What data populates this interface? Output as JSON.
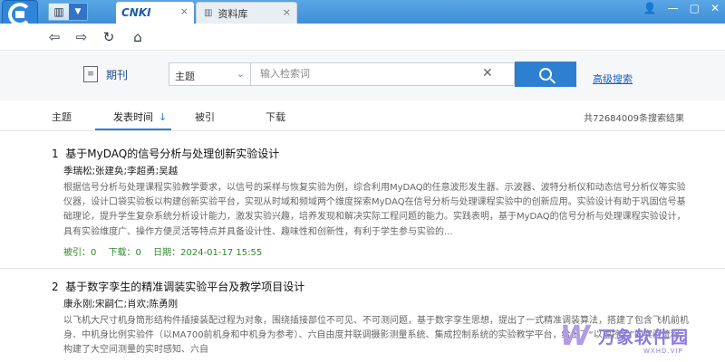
{
  "titlebar": {
    "tabs": [
      {
        "label": "CNKI",
        "icon": "cnki-icon",
        "active": true
      },
      {
        "label": "资料库",
        "icon": "library-icon",
        "active": false
      }
    ],
    "close_glyph": "×"
  },
  "search": {
    "source_label": "期刊",
    "field": "主题",
    "placeholder": "输入检索词",
    "advanced_label": "高级搜索"
  },
  "sort": {
    "options": [
      "主题",
      "发表时间",
      "被引",
      "下载"
    ],
    "active": "发表时间",
    "result_count": "共72684009条搜索结果"
  },
  "results": [
    {
      "index": "1",
      "title": "基于MyDAQ的信号分析与处理创新实验设计",
      "authors": "季瑞松;张建奂;李超勇;吴越",
      "abstract": "根据信号分析与处理课程实验教学要求，以信号的采样与恢复实验为例，综合利用MyDAQ的任意波形发生器、示波器、波特分析仪和动态信号分析仪等实验仪器，设计口袋实验板以构建创新实验平台，实现从时域和频域两个维度探索MyDAQ在信号分析与处理课程实验中的创新应用。实验设计有助于巩固信号基础理论，提升学生复杂系统分析设计能力，激发实验兴趣，培养发现和解决实际工程问题的能力。实践表明，基于MyDAQ的信号分析与处理课程实验设计，具有实验维度广、操作方便灵活等特点并具备设计性、趣味性和创新性，有利于学生参与实验的...",
      "cited": "被引：0",
      "downloads": "下载：0",
      "date": "日期：2024-01-17 15:55"
    },
    {
      "index": "2",
      "title": "基于数字孪生的精准调装实验平台及教学项目设计",
      "authors": "康永刚;宋嗣仁;肖欢;陈勇刚",
      "abstract": "以飞机大尺寸机身筒形结构件插接装配过程为对象，围绕插接部位不可见、不可测问题，基于数字孪生思想，提出了一式精准调装算法，搭建了包含飞机前机身、中机身比例实验件（以MA700前机身和中机身为参考）、六自由度并联调摄影测量系统、集成控制系统的实验教学平台，给出了“以虚控实”的实验流程。构建了大空间测量的实时感知、六自"
    }
  ],
  "watermark": {
    "text": "万象软件园",
    "sub": "WXHD.VIP"
  }
}
